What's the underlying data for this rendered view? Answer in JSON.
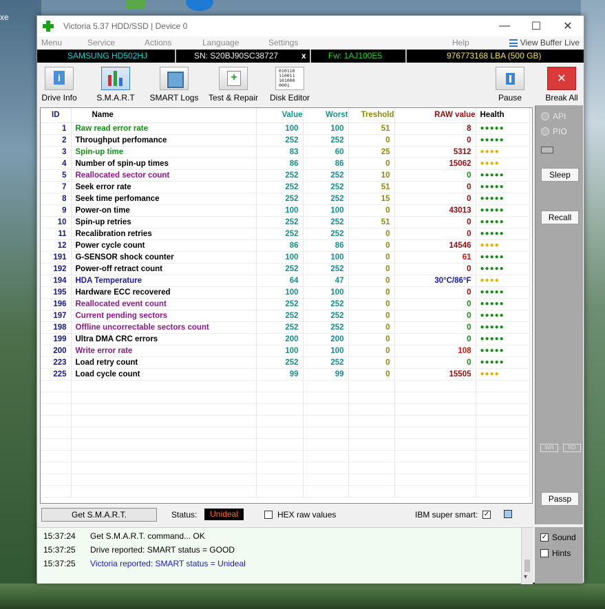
{
  "desktop": {
    "partial_text": "xe"
  },
  "window": {
    "title": "Victoria 5.37 HDD/SSD | Device 0",
    "controls": {
      "minimize": "—",
      "maximize": "☐",
      "close": "✕"
    }
  },
  "menu": {
    "items": [
      "Menu",
      "Service",
      "Actions",
      "Language",
      "Settings",
      "Help"
    ],
    "view_buffer": "View Buffer Live"
  },
  "info": {
    "model": "SAMSUNG HD502HJ",
    "serial": "SN: S20BJ90SC38727",
    "x": "x",
    "firmware": "Fw: 1AJ100E5",
    "lba": "976773168 LBA (500 GB)"
  },
  "toolbar": {
    "drive_info": "Drive Info",
    "smart": "S.M.A.R.T",
    "smart_logs": "SMART Logs",
    "test_repair": "Test & Repair",
    "disk_editor": "Disk Editor",
    "pause": "Pause",
    "break_all": "Break All"
  },
  "table": {
    "headers": [
      "ID",
      "Name",
      "Value",
      "Worst",
      "Treshold",
      "RAW value",
      "Health"
    ],
    "rows": [
      {
        "id": "1",
        "name": "Raw read error rate",
        "value": "100",
        "worst": "100",
        "thr": "51",
        "raw": "8",
        "health": "●●●●●",
        "nc": "n-green",
        "rc": "",
        "hc": "dot-g"
      },
      {
        "id": "2",
        "name": "Throughput perfomance",
        "value": "252",
        "worst": "252",
        "thr": "0",
        "raw": "0",
        "health": "●●●●●",
        "nc": "n-black",
        "rc": "",
        "hc": "dot-g"
      },
      {
        "id": "3",
        "name": "Spin-up time",
        "value": "83",
        "worst": "60",
        "thr": "25",
        "raw": "5312",
        "health": "●●●●",
        "nc": "n-green",
        "rc": "",
        "hc": "dot-y"
      },
      {
        "id": "4",
        "name": "Number of spin-up times",
        "value": "86",
        "worst": "86",
        "thr": "0",
        "raw": "15062",
        "health": "●●●●",
        "nc": "n-black",
        "rc": "",
        "hc": "dot-y"
      },
      {
        "id": "5",
        "name": "Reallocated sector count",
        "value": "252",
        "worst": "252",
        "thr": "10",
        "raw": "0",
        "health": "●●●●●",
        "nc": "n-purple",
        "rc": "raw-green",
        "hc": "dot-g"
      },
      {
        "id": "7",
        "name": "Seek error rate",
        "value": "252",
        "worst": "252",
        "thr": "51",
        "raw": "0",
        "health": "●●●●●",
        "nc": "n-black",
        "rc": "",
        "hc": "dot-g"
      },
      {
        "id": "8",
        "name": "Seek time perfomance",
        "value": "252",
        "worst": "252",
        "thr": "15",
        "raw": "0",
        "health": "●●●●●",
        "nc": "n-black",
        "rc": "",
        "hc": "dot-g"
      },
      {
        "id": "9",
        "name": "Power-on time",
        "value": "100",
        "worst": "100",
        "thr": "0",
        "raw": "43013",
        "health": "●●●●●",
        "nc": "n-black",
        "rc": "",
        "hc": "dot-g"
      },
      {
        "id": "10",
        "name": "Spin-up retries",
        "value": "252",
        "worst": "252",
        "thr": "51",
        "raw": "0",
        "health": "●●●●●",
        "nc": "n-black",
        "rc": "",
        "hc": "dot-g"
      },
      {
        "id": "11",
        "name": "Recalibration retries",
        "value": "252",
        "worst": "252",
        "thr": "0",
        "raw": "0",
        "health": "●●●●●",
        "nc": "n-black",
        "rc": "",
        "hc": "dot-g"
      },
      {
        "id": "12",
        "name": "Power cycle count",
        "value": "86",
        "worst": "86",
        "thr": "0",
        "raw": "14546",
        "health": "●●●●",
        "nc": "n-black",
        "rc": "",
        "hc": "dot-y"
      },
      {
        "id": "191",
        "name": "G-SENSOR shock counter",
        "value": "100",
        "worst": "100",
        "thr": "0",
        "raw": "61",
        "health": "●●●●●",
        "nc": "n-black",
        "rc": "raw-red",
        "hc": "dot-g"
      },
      {
        "id": "192",
        "name": "Power-off retract count",
        "value": "252",
        "worst": "252",
        "thr": "0",
        "raw": "0",
        "health": "●●●●●",
        "nc": "n-black",
        "rc": "",
        "hc": "dot-g"
      },
      {
        "id": "194",
        "name": "HDA Temperature",
        "value": "64",
        "worst": "47",
        "thr": "0",
        "raw": "30°C/86°F",
        "health": "●●●●",
        "nc": "n-blue",
        "rc": "raw-blue",
        "hc": "dot-y"
      },
      {
        "id": "195",
        "name": "Hardware ECC recovered",
        "value": "100",
        "worst": "100",
        "thr": "0",
        "raw": "0",
        "health": "●●●●●",
        "nc": "n-black",
        "rc": "",
        "hc": "dot-g"
      },
      {
        "id": "196",
        "name": "Reallocated event count",
        "value": "252",
        "worst": "252",
        "thr": "0",
        "raw": "0",
        "health": "●●●●●",
        "nc": "n-purple",
        "rc": "raw-green",
        "hc": "dot-g"
      },
      {
        "id": "197",
        "name": "Current pending sectors",
        "value": "252",
        "worst": "252",
        "thr": "0",
        "raw": "0",
        "health": "●●●●●",
        "nc": "n-purple",
        "rc": "raw-green",
        "hc": "dot-g"
      },
      {
        "id": "198",
        "name": "Offline uncorrectable sectors count",
        "value": "252",
        "worst": "252",
        "thr": "0",
        "raw": "0",
        "health": "●●●●●",
        "nc": "n-purple",
        "rc": "raw-green",
        "hc": "dot-g"
      },
      {
        "id": "199",
        "name": "Ultra DMA CRC errors",
        "value": "200",
        "worst": "200",
        "thr": "0",
        "raw": "0",
        "health": "●●●●●",
        "nc": "n-black",
        "rc": "raw-green",
        "hc": "dot-g"
      },
      {
        "id": "200",
        "name": "Write error rate",
        "value": "100",
        "worst": "100",
        "thr": "0",
        "raw": "108",
        "health": "●●●●●",
        "nc": "n-purple",
        "rc": "raw-red",
        "hc": "dot-g"
      },
      {
        "id": "223",
        "name": "Load retry count",
        "value": "252",
        "worst": "252",
        "thr": "0",
        "raw": "0",
        "health": "●●●●●",
        "nc": "n-black",
        "rc": "raw-green",
        "hc": "dot-g"
      },
      {
        "id": "225",
        "name": "Load cycle count",
        "value": "99",
        "worst": "99",
        "thr": "0",
        "raw": "15505",
        "health": "●●●●",
        "nc": "n-black",
        "rc": "",
        "hc": "dot-y"
      }
    ],
    "empty_rows": 10
  },
  "right_panel": {
    "api": "API",
    "pio": "PIO",
    "sleep": "Sleep",
    "recall": "Recall",
    "wr": "WR",
    "rd": "RD",
    "passp": "Passp"
  },
  "status": {
    "get_smart": "Get S.M.A.R.T.",
    "label": "Status:",
    "value": "Unideal",
    "hex_label": "HEX raw values",
    "ibm_label": "IBM super smart:",
    "ibm_checked": "✓"
  },
  "log": [
    {
      "time": "15:37:24",
      "msg": "Get S.M.A.R.T. command... OK",
      "cls": ""
    },
    {
      "time": "15:37:25",
      "msg": "Drive reported: SMART status = GOOD",
      "cls": ""
    },
    {
      "time": "15:37:25",
      "msg": "Victoria reported: SMART status = Unideal",
      "cls": "blue"
    }
  ],
  "options": {
    "sound": "Sound",
    "sound_checked": "✓",
    "hints": "Hints"
  }
}
